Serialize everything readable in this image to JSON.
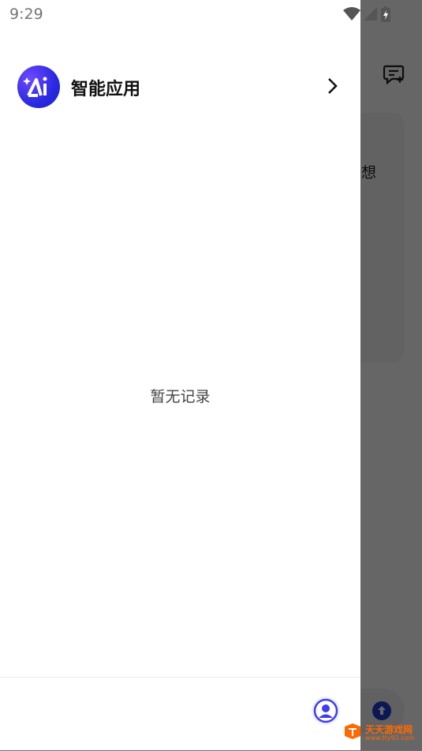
{
  "status_bar": {
    "time": "9:29"
  },
  "drawer": {
    "app_title": "智能应用",
    "empty_state": "暂无记录"
  },
  "background": {
    "card_text": "想"
  },
  "watermark": {
    "name": "天天游戏网",
    "url": "www.tty93.com"
  },
  "colors": {
    "logo": "#2a2ae0",
    "scrim": "rgba(0,0,0,0.6)"
  }
}
